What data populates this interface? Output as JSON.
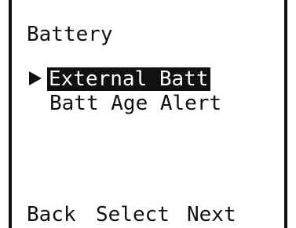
{
  "screen": {
    "title": "Battery"
  },
  "menu": {
    "items": [
      {
        "label": "External Batt",
        "selected": true
      },
      {
        "label": "Batt Age Alert",
        "selected": false
      }
    ],
    "pointer_icon": "right-triangle-icon"
  },
  "softkeys": {
    "back": "Back",
    "select": "Select",
    "next": "Next"
  },
  "colors": {
    "background": "#ffffff",
    "foreground": "#111111",
    "highlight_text": "#ffffff"
  }
}
